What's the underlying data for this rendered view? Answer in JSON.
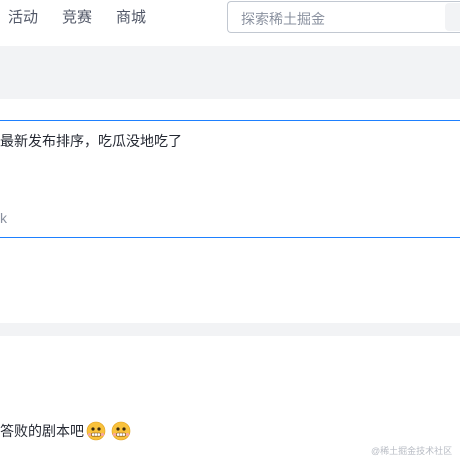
{
  "header": {
    "nav": [
      {
        "label": "活动"
      },
      {
        "label": "竞赛"
      },
      {
        "label": "商城"
      }
    ],
    "search": {
      "placeholder": "探索稀土掘金"
    }
  },
  "editor": {
    "text": "最新发布排序，吃瓜没地吃了",
    "tail": "k"
  },
  "reply": {
    "text": "答败的剧本吧"
  },
  "emojis": [
    {
      "icon": "grimace-emoji-icon"
    },
    {
      "icon": "grimace-emoji-icon"
    }
  ],
  "watermark": "@稀土掘金技术社区"
}
